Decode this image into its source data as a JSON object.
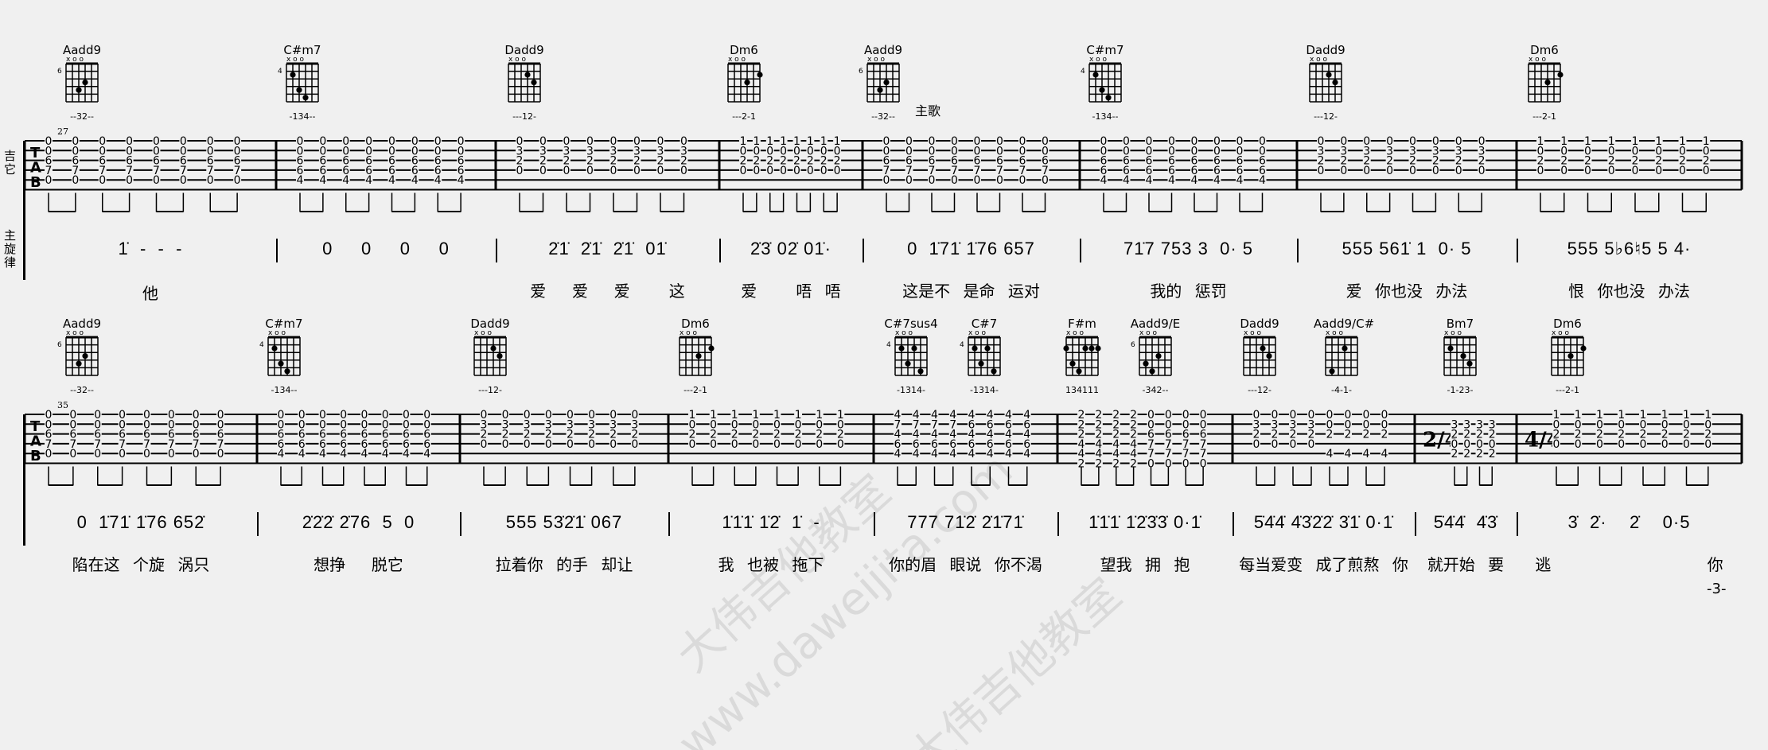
{
  "section_label": "主歌",
  "track_labels": {
    "guitar": "吉它",
    "melody": "主旋律"
  },
  "page_number": "-3-",
  "watermark": {
    "line1": "大伟吉他教室",
    "line2": "www.daweijita.com"
  },
  "rows": [
    {
      "measure_start": "27",
      "chords": [
        {
          "name": "Aadd9",
          "fingering": "--32--",
          "fret": "6"
        },
        {
          "name": "C#m7",
          "fingering": "-134--",
          "fret": "4"
        },
        {
          "name": "Dadd9",
          "fingering": "---12-",
          "fret": ""
        },
        {
          "name": "Dm6",
          "fingering": "---2-1",
          "fret": ""
        },
        {
          "name": "Aadd9",
          "fingering": "--32--",
          "fret": "6"
        },
        {
          "name": "C#m7",
          "fingering": "-134--",
          "fret": "4"
        },
        {
          "name": "Dadd9",
          "fingering": "---12-",
          "fret": ""
        },
        {
          "name": "Dm6",
          "fingering": "---2-1",
          "fret": ""
        }
      ],
      "measures": [
        {
          "tab": [
            [
              "0",
              "0",
              "6",
              "7",
              "0",
              ""
            ]
          ],
          "melody": "1̇  -  -  -",
          "lyrics": "他"
        },
        {
          "tab": [
            [
              "0",
              "0",
              "6",
              "6",
              "4",
              ""
            ]
          ],
          "melody": "0     0     0     0",
          "lyrics": ""
        },
        {
          "tab": [
            [
              "0",
              "3",
              "2",
              "0",
              "",
              ""
            ]
          ],
          "melody": "2̇1̇  2̇1̇  2̇1̇  01̇",
          "lyrics": "爱  爱  爱   这"
        },
        {
          "tab": [
            [
              "1",
              "0",
              "2",
              "0",
              "",
              ""
            ]
          ],
          "melody": "2̇3̇ 02̇ 01̇·",
          "lyrics": "爱   唔 唔"
        },
        {
          "tab": [
            [
              "0",
              "0",
              "6",
              "7",
              "0",
              ""
            ]
          ],
          "melody": "0  1̇71̇ 1̇76 657",
          "lyrics": "这是不 是命 运对"
        },
        {
          "tab": [
            [
              "0",
              "0",
              "6",
              "6",
              "4",
              ""
            ]
          ],
          "melody": "71̇7 753 3  0· 5",
          "lyrics": "我的 惩罚"
        },
        {
          "tab": [
            [
              "0",
              "3",
              "2",
              "0",
              "",
              ""
            ]
          ],
          "melody": "555 561̇ 1  0· 5",
          "lyrics": "爱 你也没 办法"
        },
        {
          "tab": [
            [
              "1",
              "0",
              "2",
              "0",
              "",
              ""
            ]
          ],
          "melody": "555 5♭6♮5 5 4·",
          "lyrics": "恨 你也没 办法"
        }
      ]
    },
    {
      "measure_start": "35",
      "chords": [
        {
          "name": "Aadd9",
          "fingering": "--32--",
          "fret": "6"
        },
        {
          "name": "C#m7",
          "fingering": "-134--",
          "fret": "4"
        },
        {
          "name": "Dadd9",
          "fingering": "---12-",
          "fret": ""
        },
        {
          "name": "Dm6",
          "fingering": "---2-1",
          "fret": ""
        },
        {
          "name": "C#7sus4",
          "fingering": "-1314-",
          "fret": "4"
        },
        {
          "name": "C#7",
          "fingering": "-1314-",
          "fret": "4"
        },
        {
          "name": "F#m",
          "fingering": "134111",
          "fret": ""
        },
        {
          "name": "Aadd9/E",
          "fingering": "-342--",
          "fret": "6"
        },
        {
          "name": "Dadd9",
          "fingering": "---12-",
          "fret": ""
        },
        {
          "name": "Aadd9/C#",
          "fingering": "-4-1-",
          "fret": ""
        },
        {
          "name": "Bm7",
          "fingering": "-1-23-",
          "fret": ""
        },
        {
          "name": "Dm6",
          "fingering": "---2-1",
          "fret": ""
        }
      ],
      "measures": [
        {
          "tab": [
            [
              "0",
              "0",
              "6",
              "7",
              "0",
              ""
            ]
          ],
          "melody": "0  1̇71̇ 1̇76 652̇",
          "lyrics": "陷在这 个旋 涡只"
        },
        {
          "tab": [
            [
              "0",
              "0",
              "6",
              "6",
              "4",
              ""
            ]
          ],
          "melody": "2̇2̇2̇ 2̇76  5  0",
          "lyrics": "想挣  脱它"
        },
        {
          "tab": [
            [
              "0",
              "3",
              "2",
              "0",
              "",
              ""
            ]
          ],
          "melody": "555 53̇2̇1̇ 067",
          "lyrics": "拉着你 的手 却让"
        },
        {
          "tab": [
            [
              "1",
              "0",
              "2",
              "0",
              "",
              ""
            ]
          ],
          "melody": "1̇1̇1̇ 1̇2̇  1̇  -",
          "lyrics": "我 也被 拖下"
        },
        {
          "tab": [
            [
              "4",
              "7",
              "4",
              "6",
              "4",
              ""
            ],
            [
              "4",
              "6",
              "4",
              "6",
              "4",
              ""
            ]
          ],
          "melody": "777 71̇2̇ 2̇1̇71̇",
          "lyrics": "你的眉 眼说 你不渴"
        },
        {
          "tab": [
            [
              "2",
              "2",
              "2",
              "4",
              "4",
              "2"
            ],
            [
              "0",
              "0",
              "6",
              "7",
              "7",
              "0"
            ]
          ],
          "melody": "1̇1̇1̇ 1̇2̇3̇3̇ 0·1̇",
          "lyrics": "望我 拥 抱"
        },
        {
          "tab": [
            [
              "0",
              "3",
              "2",
              "0",
              "",
              ""
            ],
            [
              "0",
              "0",
              "2",
              "",
              "4",
              ""
            ]
          ],
          "melody": "5̇4̇4̇ 4̇3̇2̇2̇ 3̇1̇ 0·1̇",
          "lyrics": "每当爱变 成了煎熬 你"
        },
        {
          "tab": [
            [
              "",
              "3",
              "2",
              "0",
              "2",
              ""
            ]
          ],
          "time": "2/4",
          "melody": "5̇4̇4̇  4̇3̇",
          "lyrics": "就开始 要"
        },
        {
          "tab": [
            [
              "1",
              "0",
              "2",
              "0",
              "",
              ""
            ]
          ],
          "time": "4/4",
          "melody": "3̇  2̇·    2̇    0·5",
          "lyrics": "逃            你"
        }
      ]
    }
  ]
}
